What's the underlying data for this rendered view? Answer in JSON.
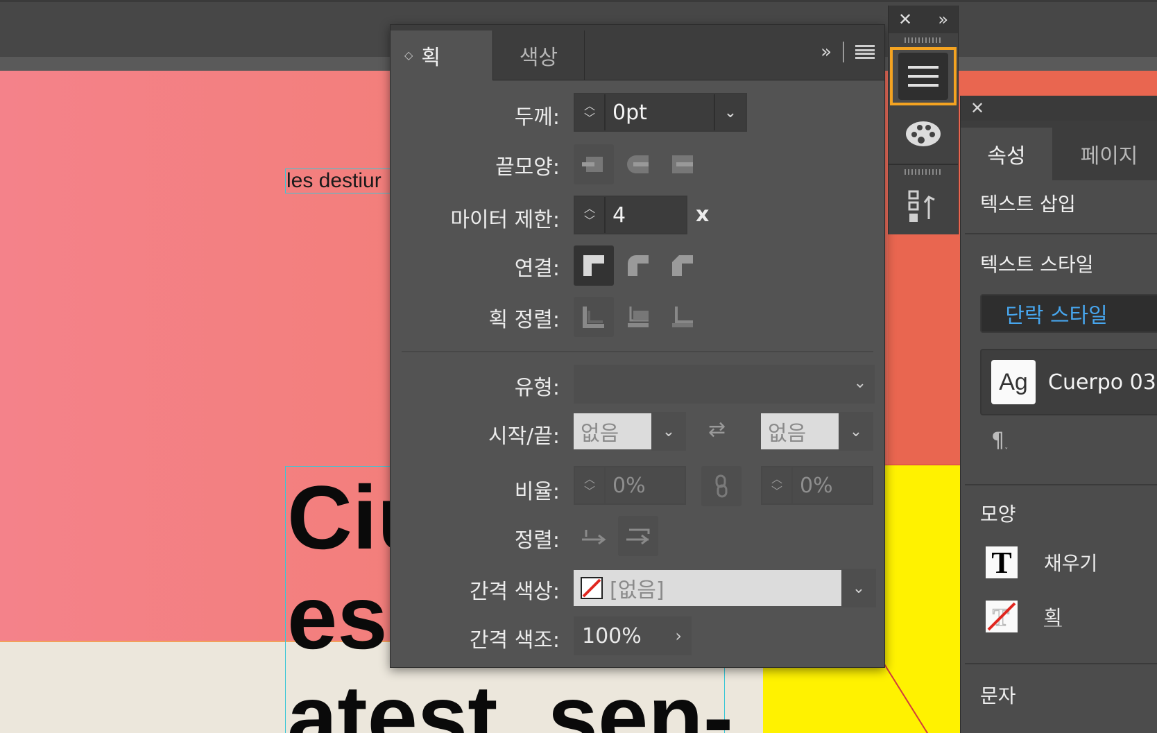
{
  "canvas": {
    "small_frame_text": "les destiur",
    "big_frame_lines": [
      "Ciu",
      "esc",
      "atest  sen-"
    ]
  },
  "stroke_panel": {
    "tabs": {
      "stroke": "획",
      "color": "색상"
    },
    "weight": {
      "label": "두께:",
      "value": "0pt"
    },
    "cap": {
      "label": "끝모양:"
    },
    "miter": {
      "label": "마이터 제한:",
      "value": "4",
      "suffix": "x"
    },
    "join": {
      "label": "연결:"
    },
    "align_stroke": {
      "label": "획 정렬:"
    },
    "type": {
      "label": "유형:",
      "value": ""
    },
    "start_end": {
      "label": "시작/끝:",
      "start": "없음",
      "end": "없음"
    },
    "scale": {
      "label": "비율:",
      "start": "0%",
      "end": "0%"
    },
    "align": {
      "label": "정렬:"
    },
    "gap_color": {
      "label": "간격 색상:",
      "value": "[없음]"
    },
    "gap_tint": {
      "label": "간격 색조:",
      "value": "100%"
    }
  },
  "properties_panel": {
    "tabs": {
      "properties": "속성",
      "pages": "페이지"
    },
    "insert_text": "텍스트 삽입",
    "text_style": "텍스트 스타일",
    "paragraph_style_button": "단락 스타일",
    "style_preview_glyph": "Ag",
    "style_name": "Cuerpo 03",
    "appearance": "모양",
    "fill": "채우기",
    "stroke": "획",
    "character": "문자"
  },
  "colors": {
    "accent_highlight": "#f4a321",
    "link_blue": "#47a6ee",
    "none_red": "#e0261f"
  },
  "icons": [
    "close-icon",
    "expand-panels-icon",
    "panel-menu-icon",
    "swatches-palette-icon",
    "stroke-panel-icon",
    "chevron-down-icon",
    "swap-arrows-icon",
    "link-icon",
    "pilcrow-icon"
  ]
}
